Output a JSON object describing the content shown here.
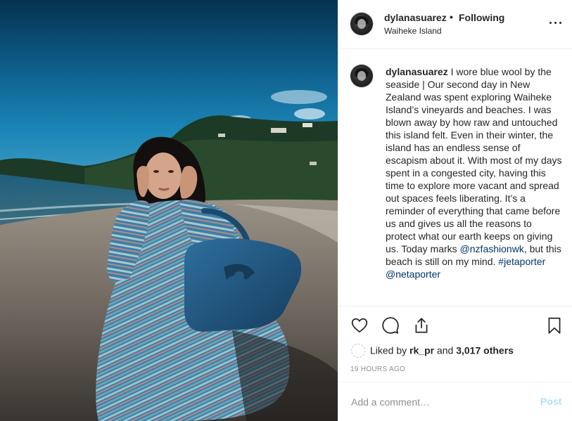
{
  "post": {
    "username": "dylanasuarez",
    "separator": "•",
    "follow_status": "Following",
    "location": "Waiheke Island"
  },
  "caption": {
    "username": "dylanasuarez",
    "text_1": "I wore blue wool by the seaside | Our second day in New Zealand was spent exploring Waiheke Island’s vineyards and beaches. I was blown away by how raw and untouched this island felt. Even in their winter, the island has an endless sense of escapism about it. With most of my days spent in a congested city, having this time to explore more vacant and spread out spaces feels liberating. It’s a reminder of everything that came before us and gives us all the reasons to protect what our earth keeps on giving us. Today marks",
    "mention_1": "@nzfashionwk",
    "text_2": ", but this beach is still on my mind.",
    "hashtag": "#jetaporter",
    "mention_2": "@netaporter"
  },
  "likes": {
    "prefix": "Liked by",
    "liker": "rk_pr",
    "conj": "and",
    "others": "3,017 others"
  },
  "timestamp": "19 HOURS AGO",
  "comment_box": {
    "placeholder": "Add a comment…",
    "post_label": "Post"
  },
  "icons": {
    "like": "heart-icon",
    "comment": "comment-bubble-icon",
    "share": "share-icon",
    "save": "bookmark-icon",
    "more": "more-options-icon"
  },
  "colors": {
    "link": "#003569",
    "post_disabled": "#b2dffc",
    "muted": "#8e8e8e",
    "text": "#262626"
  }
}
